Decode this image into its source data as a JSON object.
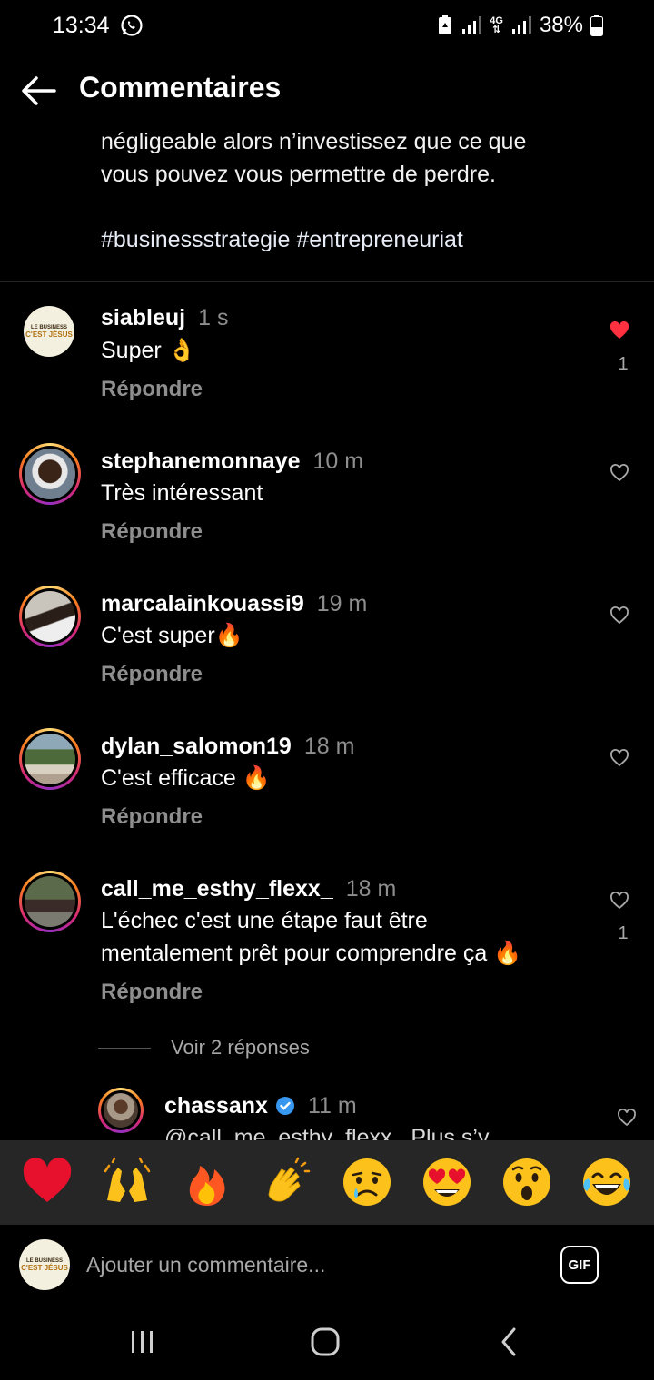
{
  "status_bar": {
    "time": "13:34",
    "battery": "38%",
    "network": "4G"
  },
  "header": {
    "title": "Commentaires",
    "back_icon": "arrow-left-icon"
  },
  "caption": {
    "text_line1": "négligeable alors n’investissez que ce que",
    "text_line2": "vous pouvez vous permettre de perdre.",
    "hashtags": "#businessstrategie #entrepreneuriat"
  },
  "comments": [
    {
      "user": "siableuj",
      "time": "1 s",
      "text": "Super 👌",
      "reply": "Répondre",
      "liked": true,
      "likes": "1"
    },
    {
      "user": "stephanemonnaye",
      "time": "10 m",
      "text": "Très intéressant",
      "reply": "Répondre",
      "liked": false,
      "likes": ""
    },
    {
      "user": "marcalainkouassi9",
      "time": "19 m",
      "text": "C'est super🔥",
      "reply": "Répondre",
      "liked": false,
      "likes": ""
    },
    {
      "user": "dylan_salomon19",
      "time": "18 m",
      "text": "C'est efficace 🔥",
      "reply": "Répondre",
      "liked": false,
      "likes": ""
    },
    {
      "user": "call_me_esthy_flexx_",
      "time": "18 m",
      "text_line1": "L'échec c'est une étape faut être",
      "text_line2": "mentalement prêt pour comprendre ça 🔥",
      "reply": "Répondre",
      "liked": false,
      "likes": "1"
    }
  ],
  "view_replies": "Voir 2 réponses",
  "reply_comment": {
    "user": "chassanx",
    "time": "11 m",
    "text": "@call_me_esthy_flexx_ Plus s’y",
    "verified": true
  },
  "avatar_logo": {
    "line1": "LE BUSINESS",
    "line2": "C'EST JÉSUS"
  },
  "emoji_bar": [
    "❤️",
    "🙌",
    "🔥",
    "👏",
    "😢",
    "😍",
    "😮",
    "😂"
  ],
  "input": {
    "placeholder": "Ajouter un commentaire...",
    "gif_label": "GIF"
  },
  "colors": {
    "like_red": "#ff3040",
    "muted": "#8e8e8e",
    "bar_bg": "#262626"
  }
}
